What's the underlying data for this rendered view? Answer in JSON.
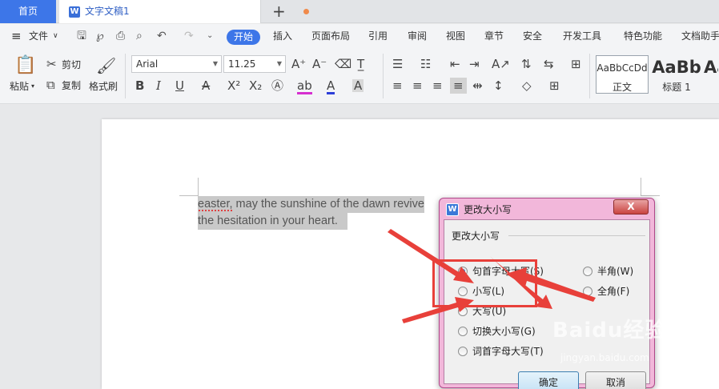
{
  "tabs": {
    "home": "首页",
    "document": "文字文稿1"
  },
  "menu": {
    "file": "文件",
    "active": "开始",
    "items": [
      "插入",
      "页面布局",
      "引用",
      "审阅",
      "视图",
      "章节",
      "安全",
      "开发工具",
      "特色功能",
      "文档助手"
    ]
  },
  "ribbon": {
    "paste": "粘贴",
    "cut": "剪切",
    "copy": "复制",
    "format_painter": "格式刷",
    "font_name": "Arial",
    "font_size": "11.25",
    "styles": [
      {
        "preview": "AaBbCcDd",
        "name": "正文"
      },
      {
        "preview": "AaBb",
        "name": "标题 1"
      },
      {
        "preview": "Aa",
        "name": ""
      }
    ]
  },
  "document": {
    "line1": "easter, may the sunshine of the dawn revive",
    "line2": "the hesitation in your heart."
  },
  "dialog": {
    "title": "更改大小写",
    "close": "X",
    "group_label": "更改大小写",
    "options": [
      {
        "label": "句首字母大写(S)",
        "checked": true
      },
      {
        "label": "小写(L)",
        "checked": false
      },
      {
        "label": "大写(U)",
        "checked": false
      },
      {
        "label": "切换大小写(G)",
        "checked": false
      },
      {
        "label": "词首字母大写(T)",
        "checked": false
      }
    ],
    "width_options": [
      {
        "label": "半角(W)",
        "checked": false
      },
      {
        "label": "全角(F)",
        "checked": false
      }
    ],
    "ok": "确定",
    "cancel": "取消"
  },
  "watermark": {
    "text": "Baidu经验",
    "sub": "jingyan.baidu.com"
  },
  "annotation_color": "#e8403a",
  "accent_color": "#3d76e8"
}
